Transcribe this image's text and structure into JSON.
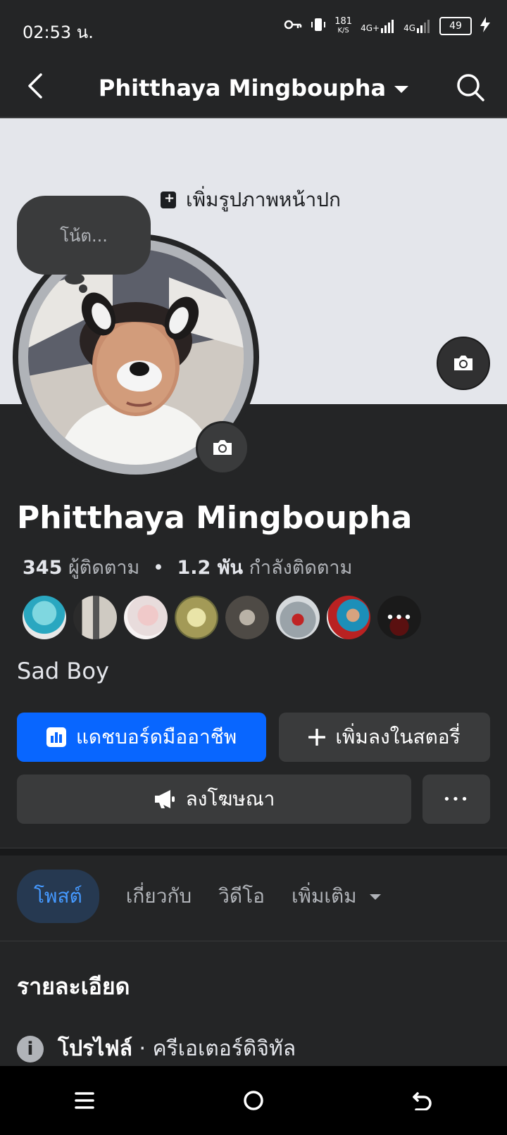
{
  "status": {
    "time": "02:53 น.",
    "speed": "181",
    "speed_unit": "K/S",
    "net1": "4G+",
    "net2": "4G",
    "battery": "49"
  },
  "appbar": {
    "title": "Phitthaya Mingboupha",
    "back_icon": "chevron-left-icon",
    "search_icon": "search-icon"
  },
  "cover": {
    "add_label": "เพิ่มรูปภาพหน้าปก"
  },
  "note": {
    "placeholder": "โน้ต..."
  },
  "profile": {
    "name": "Phitthaya Mingboupha",
    "followers_count": "345",
    "followers_label": "ผู้ติดตาม",
    "following_count": "1.2 พัน",
    "following_label": "กำลังติดตาม",
    "bio": "Sad Boy"
  },
  "friends": {
    "more_label": "•••"
  },
  "buttons": {
    "dashboard": "แดชบอร์ดมืออาชีพ",
    "add_story": "เพิ่มลงในสตอรี่",
    "advertise": "ลงโฆษณา",
    "more": "•••"
  },
  "tabs": [
    {
      "label": "โพสต์"
    },
    {
      "label": "เกี่ยวกับ"
    },
    {
      "label": "วิดีโอ"
    },
    {
      "label": "เพิ่มเติม"
    }
  ],
  "details": {
    "title": "รายละเอียด",
    "profile_label": "โปรไฟล์",
    "profile_value": " · ครีเอเตอร์ดิจิทัล"
  },
  "colors": {
    "accent": "#0866ff",
    "background": "#242526"
  }
}
